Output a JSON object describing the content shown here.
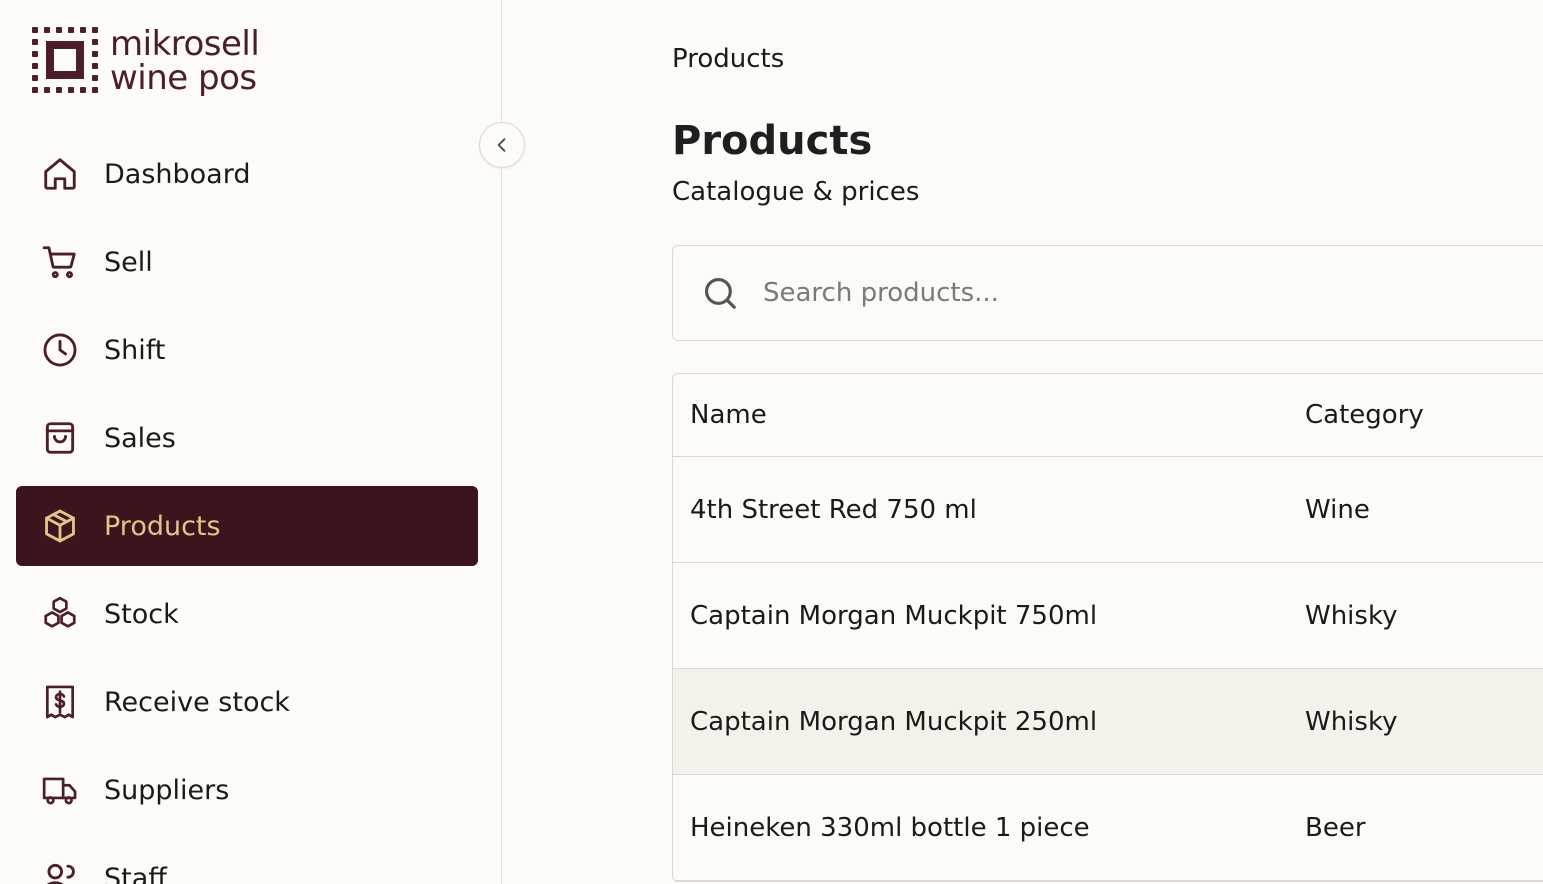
{
  "brand": {
    "line1": "mikrosell",
    "line2": "wine pos"
  },
  "colors": {
    "accent": "#3c141e",
    "active_text": "#e3c389",
    "icon": "#4a1e2a"
  },
  "sidebar": {
    "items": [
      {
        "label": "Dashboard",
        "icon": "home-icon"
      },
      {
        "label": "Sell",
        "icon": "cart-icon"
      },
      {
        "label": "Shift",
        "icon": "clock-icon"
      },
      {
        "label": "Sales",
        "icon": "shopping-bag-icon"
      },
      {
        "label": "Products",
        "icon": "package-icon",
        "active": true
      },
      {
        "label": "Stock",
        "icon": "boxes-icon"
      },
      {
        "label": "Receive stock",
        "icon": "receipt-icon"
      },
      {
        "label": "Suppliers",
        "icon": "truck-icon"
      },
      {
        "label": "Staff",
        "icon": "users-icon"
      }
    ]
  },
  "main": {
    "breadcrumb": "Products",
    "title": "Products",
    "subtitle": "Catalogue & prices",
    "search": {
      "placeholder": "Search products...",
      "value": ""
    },
    "table": {
      "columns": [
        "Name",
        "Category"
      ],
      "rows": [
        {
          "name": "4th Street Red 750 ml",
          "category": "Wine"
        },
        {
          "name": "Captain Morgan Muckpit 750ml",
          "category": "Whisky"
        },
        {
          "name": "Captain Morgan Muckpit 250ml",
          "category": "Whisky"
        },
        {
          "name": "Heineken 330ml bottle 1 piece",
          "category": "Beer"
        }
      ]
    }
  }
}
